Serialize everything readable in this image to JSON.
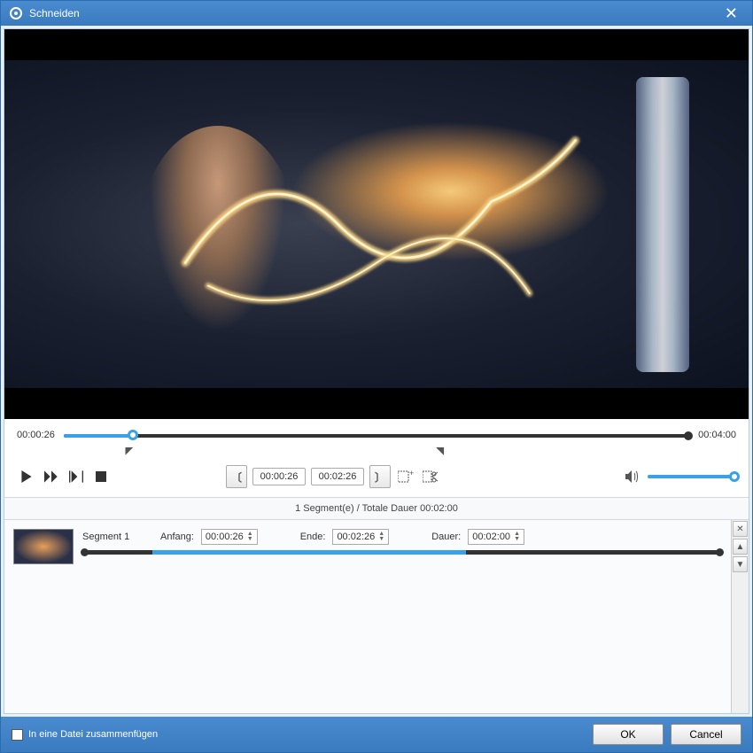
{
  "window": {
    "title": "Schneiden"
  },
  "timeline": {
    "current": "00:00:26",
    "total": "00:04:00"
  },
  "trim": {
    "start": "00:00:26",
    "end": "00:02:26"
  },
  "summary": "1 Segment(e) / Totale Dauer 00:02:00",
  "segment": {
    "name": "Segment 1",
    "start_label": "Anfang:",
    "start_value": "00:00:26",
    "end_label": "Ende:",
    "end_value": "00:02:26",
    "duration_label": "Dauer:",
    "duration_value": "00:02:00"
  },
  "footer": {
    "merge_label": "In eine Datei zusammenfügen",
    "ok": "OK",
    "cancel": "Cancel"
  }
}
